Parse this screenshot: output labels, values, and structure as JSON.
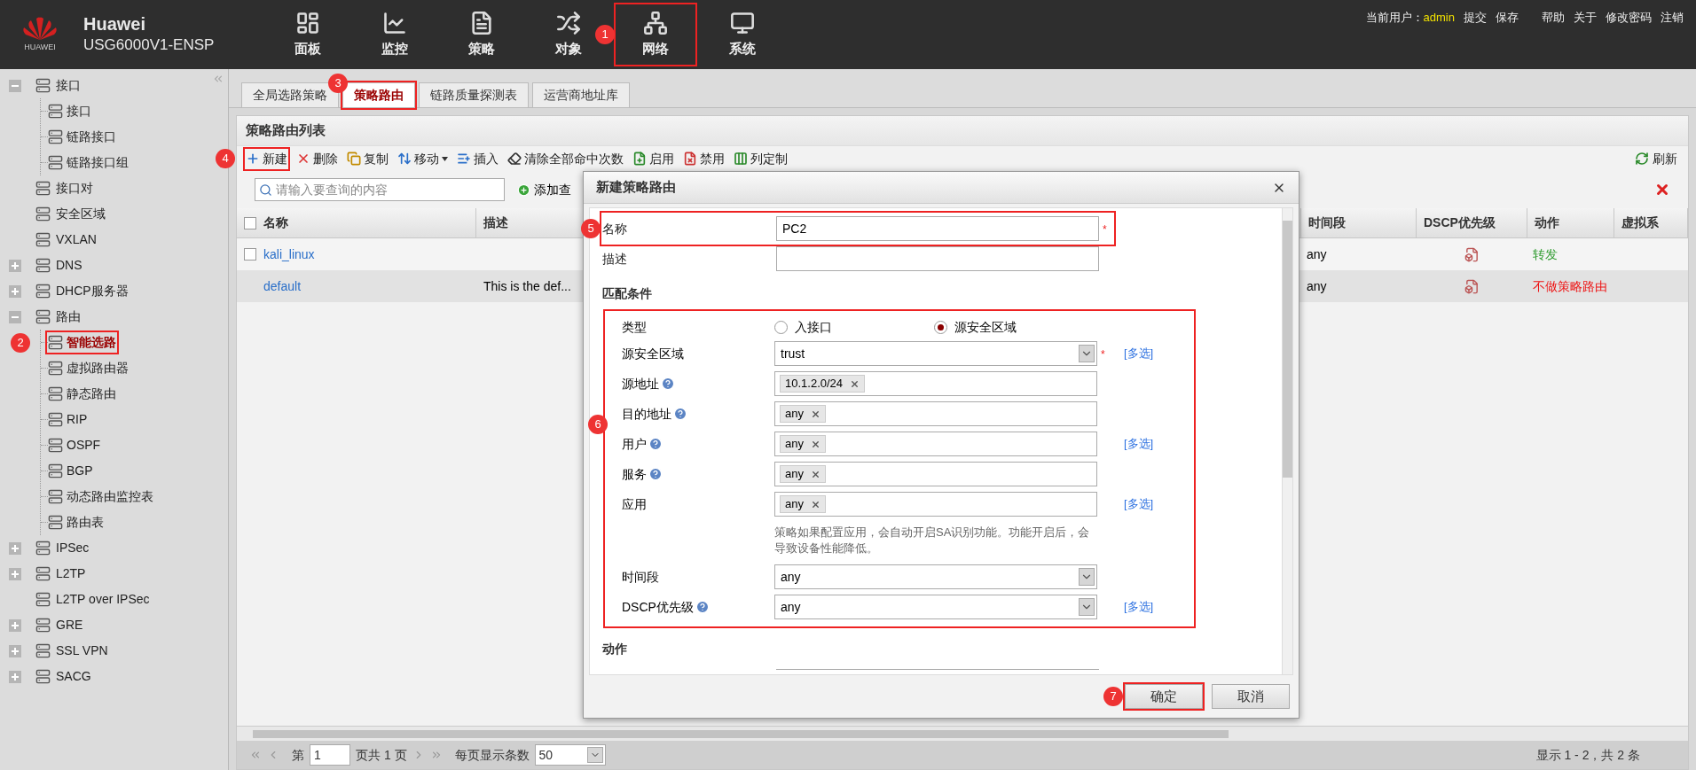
{
  "header": {
    "brand": "Huawei",
    "brand_caption": "HUAWEI",
    "product": "USG6000V1-ENSP",
    "nav": [
      {
        "label": "面板"
      },
      {
        "label": "监控"
      },
      {
        "label": "策略"
      },
      {
        "label": "对象"
      },
      {
        "label": "网络",
        "callout": "1"
      },
      {
        "label": "系统"
      }
    ],
    "user_label": "当前用户：",
    "user": "admin",
    "links": [
      "提交",
      "保存",
      "帮助",
      "关于",
      "修改密码",
      "注销"
    ]
  },
  "sidebar": {
    "items": [
      {
        "label": "接口",
        "expanded": true,
        "children": [
          {
            "label": "接口"
          },
          {
            "label": "链路接口"
          },
          {
            "label": "链路接口组"
          }
        ]
      },
      {
        "label": "接口对"
      },
      {
        "label": "安全区域"
      },
      {
        "label": "VXLAN"
      },
      {
        "label": "DNS",
        "expanded": false
      },
      {
        "label": "DHCP服务器",
        "expanded": false
      },
      {
        "label": "路由",
        "expanded": true,
        "children": [
          {
            "label": "智能选路",
            "selected": true,
            "callout": "2"
          },
          {
            "label": "虚拟路由器",
            "selected": false
          },
          {
            "label": "静态路由",
            "selected": false
          },
          {
            "label": "RIP",
            "selected": false
          },
          {
            "label": "OSPF",
            "selected": false
          },
          {
            "label": "BGP",
            "selected": false
          },
          {
            "label": "动态路由监控表",
            "selected": false
          },
          {
            "label": "路由表",
            "selected": false
          }
        ]
      },
      {
        "label": "IPSec",
        "expanded": false
      },
      {
        "label": "L2TP",
        "expanded": false
      },
      {
        "label": "L2TP over IPSec"
      },
      {
        "label": "GRE",
        "expanded": false
      },
      {
        "label": "SSL VPN",
        "expanded": false
      },
      {
        "label": "SACG",
        "expanded": false
      }
    ]
  },
  "tabs": [
    {
      "label": "全局选路策略",
      "selected": false
    },
    {
      "label": "策略路由",
      "selected": true,
      "callout": "3"
    },
    {
      "label": "链路质量探测表",
      "selected": false
    },
    {
      "label": "运营商地址库",
      "selected": false
    }
  ],
  "panel": {
    "title": "策略路由列表",
    "toolbar": [
      {
        "label": "新建",
        "callout": "4"
      },
      {
        "label": "删除"
      },
      {
        "label": "复制"
      },
      {
        "label": "移动",
        "menu": true
      },
      {
        "label": "插入"
      },
      {
        "label": "清除全部命中次数"
      },
      {
        "label": "启用"
      },
      {
        "label": "禁用"
      },
      {
        "label": "列定制"
      }
    ],
    "refresh": "刷新",
    "search_placeholder": "请输入要查询的内容",
    "add_query": "添加查",
    "all_checked": false,
    "columns": [
      "名称",
      "描述",
      "时间段",
      "DSCP优先级",
      "动作",
      "虚拟系"
    ],
    "rows": [
      {
        "checked": false,
        "name": "kali_linux",
        "time": "any",
        "action": "转发",
        "color": "#2e9b2e"
      },
      {
        "name": "default",
        "description": "This is the def...",
        "time": "any",
        "action": "不做策略路由",
        "color": "#ee1111"
      }
    ],
    "pager": {
      "page_prefix": "第",
      "page": "1",
      "page_suffix": "页共 1 页",
      "size_label": "每页显示条数",
      "size": "50",
      "summary": "显示 1 - 2，共 2 条"
    }
  },
  "dialog": {
    "title": "新建策略路由",
    "required_mark": "*",
    "name": {
      "label": "名称",
      "value": "PC2",
      "required": true,
      "callout": "5"
    },
    "description": {
      "label": "描述"
    },
    "match_title": "匹配条件",
    "conditions": {
      "callout": "6",
      "type_label": "类型",
      "type_options": [
        {
          "label": "入接口",
          "selected": false
        },
        {
          "label": "源安全区域",
          "selected": true
        }
      ],
      "rows": [
        {
          "kind": "select",
          "label": "源安全区域",
          "value": "trust",
          "required": true,
          "link": "[多选]"
        },
        {
          "kind": "tags",
          "label": "源地址",
          "help": true,
          "tags": [
            "10.1.2.0/24"
          ]
        },
        {
          "kind": "tags",
          "label": "目的地址",
          "help": true,
          "tags": [
            "any"
          ]
        },
        {
          "kind": "tags",
          "label": "用户",
          "help": true,
          "tags": [
            "any"
          ],
          "link": "[多选]"
        },
        {
          "kind": "tags",
          "label": "服务",
          "help": true,
          "tags": [
            "any"
          ]
        },
        {
          "kind": "tags",
          "label": "应用",
          "tags": [
            "any"
          ],
          "link": "[多选]",
          "note": "策略如果配置应用，会自动开启SA识别功能。功能开启后，会导致设备性能降低。"
        },
        {
          "kind": "select",
          "label": "时间段",
          "value": "any"
        },
        {
          "kind": "select",
          "label": "DSCP优先级",
          "help": true,
          "value": "any",
          "link": "[多选]"
        }
      ]
    },
    "action_title": "动作",
    "buttons": [
      {
        "label": "确定",
        "callout": "7"
      },
      {
        "label": "取消"
      }
    ]
  }
}
